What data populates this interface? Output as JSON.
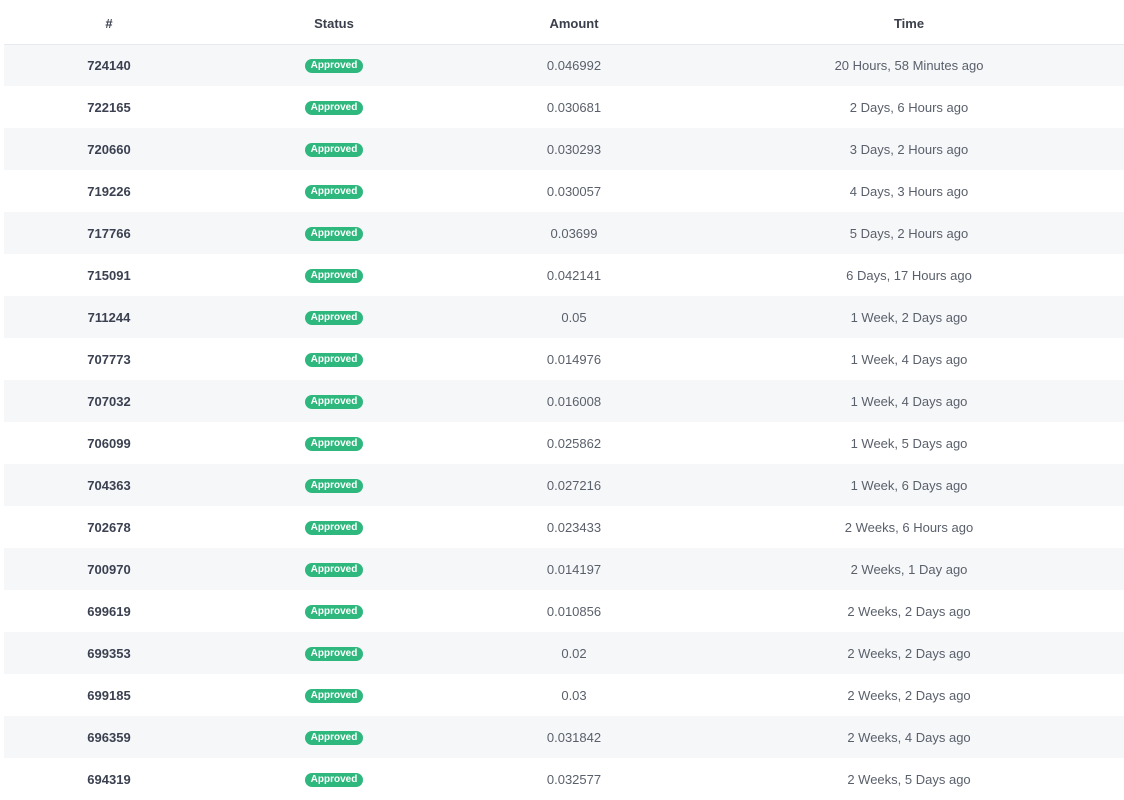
{
  "table": {
    "columns": [
      "#",
      "Status",
      "Amount",
      "Time"
    ],
    "rows": [
      {
        "id": "724140",
        "status": "Approved",
        "amount": "0.046992",
        "time": "20 Hours, 58 Minutes ago"
      },
      {
        "id": "722165",
        "status": "Approved",
        "amount": "0.030681",
        "time": "2 Days, 6 Hours ago"
      },
      {
        "id": "720660",
        "status": "Approved",
        "amount": "0.030293",
        "time": "3 Days, 2 Hours ago"
      },
      {
        "id": "719226",
        "status": "Approved",
        "amount": "0.030057",
        "time": "4 Days, 3 Hours ago"
      },
      {
        "id": "717766",
        "status": "Approved",
        "amount": "0.03699",
        "time": "5 Days, 2 Hours ago"
      },
      {
        "id": "715091",
        "status": "Approved",
        "amount": "0.042141",
        "time": "6 Days, 17 Hours ago"
      },
      {
        "id": "711244",
        "status": "Approved",
        "amount": "0.05",
        "time": "1 Week, 2 Days ago"
      },
      {
        "id": "707773",
        "status": "Approved",
        "amount": "0.014976",
        "time": "1 Week, 4 Days ago"
      },
      {
        "id": "707032",
        "status": "Approved",
        "amount": "0.016008",
        "time": "1 Week, 4 Days ago"
      },
      {
        "id": "706099",
        "status": "Approved",
        "amount": "0.025862",
        "time": "1 Week, 5 Days ago"
      },
      {
        "id": "704363",
        "status": "Approved",
        "amount": "0.027216",
        "time": "1 Week, 6 Days ago"
      },
      {
        "id": "702678",
        "status": "Approved",
        "amount": "0.023433",
        "time": "2 Weeks, 6 Hours ago"
      },
      {
        "id": "700970",
        "status": "Approved",
        "amount": "0.014197",
        "time": "2 Weeks, 1 Day ago"
      },
      {
        "id": "699619",
        "status": "Approved",
        "amount": "0.010856",
        "time": "2 Weeks, 2 Days ago"
      },
      {
        "id": "699353",
        "status": "Approved",
        "amount": "0.02",
        "time": "2 Weeks, 2 Days ago"
      },
      {
        "id": "699185",
        "status": "Approved",
        "amount": "0.03",
        "time": "2 Weeks, 2 Days ago"
      },
      {
        "id": "696359",
        "status": "Approved",
        "amount": "0.031842",
        "time": "2 Weeks, 4 Days ago"
      },
      {
        "id": "694319",
        "status": "Approved",
        "amount": "0.032577",
        "time": "2 Weeks, 5 Days ago"
      }
    ]
  },
  "colors": {
    "approved_badge": "#2fb87d",
    "stripe": "#f6f7f9",
    "header_text": "#3a3f4b"
  }
}
